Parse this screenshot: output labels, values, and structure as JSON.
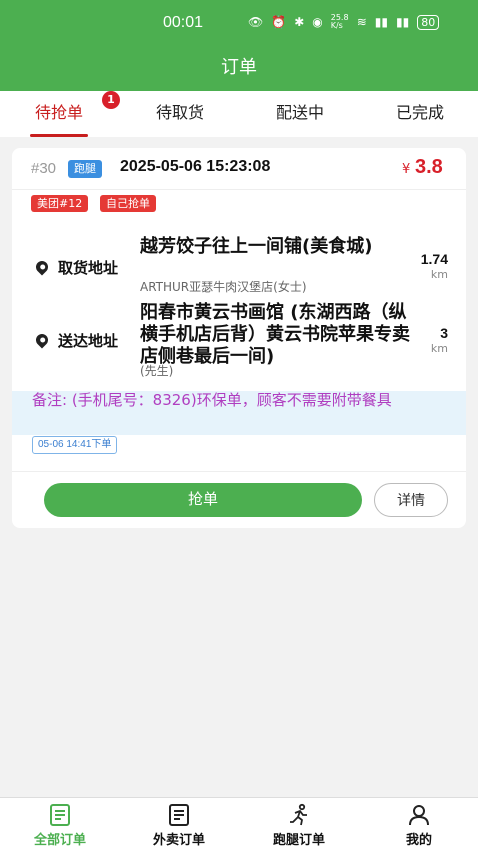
{
  "status_bar": {
    "time": "00:01",
    "net_speed": "25.8 K/s",
    "battery": "80"
  },
  "header": {
    "title": "订单"
  },
  "tabs": [
    {
      "label": "待抢单",
      "active": true,
      "badge": "1"
    },
    {
      "label": "待取货"
    },
    {
      "label": "配送中"
    },
    {
      "label": "已完成"
    }
  ],
  "order": {
    "number": "#30",
    "type_tag": "跑腿",
    "created_at": "2025-05-06 15:23:08",
    "currency": "¥",
    "price": "3.8",
    "tags": [
      "美团#12",
      "自己抢单"
    ],
    "pickup": {
      "label": "取货地址",
      "name": "越芳饺子往上一间铺(美食城)",
      "sub": "ARTHUR亚瑟牛肉汉堡店(女士)",
      "distance": "1.74",
      "unit": "km"
    },
    "delivery": {
      "label": "送达地址",
      "name": "阳春市黄云书画馆 (东湖西路（纵横手机店后背）黄云书院苹果专卖店侧巷最后一间)",
      "sub": "(先生)",
      "distance": "3",
      "unit": "km"
    },
    "note": "备注: (手机尾号：8326)环保单，顾客不需要附带餐具",
    "order_time_tag": "05-06 14:41下单",
    "grab_button": "抢单",
    "detail_button": "详情"
  },
  "bottom_nav": [
    {
      "label": "全部订单",
      "icon": "list-icon",
      "active": true
    },
    {
      "label": "外卖订单",
      "icon": "list-icon"
    },
    {
      "label": "跑腿订单",
      "icon": "runner-icon"
    },
    {
      "label": "我的",
      "icon": "user-icon"
    }
  ],
  "colors": {
    "brand": "#4caf50",
    "accent_red": "#d8202a",
    "note_text": "#b03ec0"
  }
}
